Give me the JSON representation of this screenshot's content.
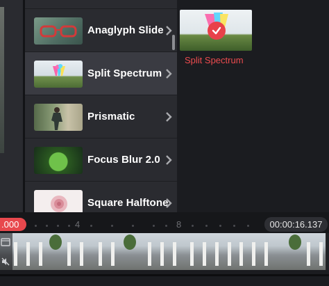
{
  "effects": [
    {
      "label": "Anaglyph Slide",
      "thumb": "glasses-thumbnail"
    },
    {
      "label": "Split Spectrum",
      "thumb": "split-spectrum-thumbnail",
      "selected": true
    },
    {
      "label": "Prismatic",
      "thumb": "prismatic-thumbnail"
    },
    {
      "label": "Focus Blur 2.0",
      "thumb": "focus-blur-thumbnail"
    },
    {
      "label": "Square Halftone",
      "thumb": "halftone-thumbnail"
    }
  ],
  "selected": {
    "caption": "Split Spectrum",
    "badge_icon": "checkmark-icon"
  },
  "timeline": {
    "current_time": ".000",
    "total_time": "00:00:16.137",
    "ticks": [
      "4",
      "8"
    ]
  },
  "colors": {
    "accent": "#e8414a",
    "caption": "#ec4b4e",
    "panel": "#2a2b30",
    "selected_row": "#3a3b42"
  },
  "icons": {
    "chevron": "chevron-right-icon",
    "track": "music-note-icon",
    "mute": "mute-icon"
  }
}
